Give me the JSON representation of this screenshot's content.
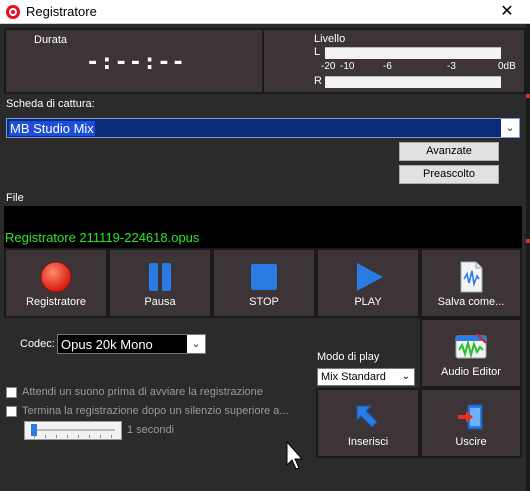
{
  "window": {
    "title": "Registratore",
    "close_glyph": "✕"
  },
  "display": {
    "duration_label": "Durata",
    "duration_value": "-:--:--",
    "level_label": "Livello",
    "left_channel": "L",
    "right_channel": "R",
    "scale": [
      "-20",
      "-10",
      "-6",
      "-3",
      "0dB"
    ]
  },
  "capture": {
    "label": "Scheda di cattura:",
    "selected": "MB Studio Mix",
    "advanced_button": "Avanzate",
    "preview_button": "Preascolto"
  },
  "file": {
    "label": "File",
    "name": "Registratore 211119-224618.opus",
    "name_color": "#2ee62e"
  },
  "transport": [
    {
      "label": "Registratore",
      "icon": "record-icon"
    },
    {
      "label": "Pausa",
      "icon": "pause-icon"
    },
    {
      "label": "STOP",
      "icon": "stop-icon"
    },
    {
      "label": "PLAY",
      "icon": "play-icon"
    },
    {
      "label": "Salva come...",
      "icon": "save-audio-icon"
    }
  ],
  "codec": {
    "label": "Codec:",
    "selected": "Opus 20k Mono"
  },
  "play_mode": {
    "label": "Modo di play",
    "selected": "Mix Standard"
  },
  "options": {
    "wait_sound": "Attendi un suono prima di avviare la registrazione",
    "stop_silence": "Termina la registrazione dopo un silenzio superiore a...",
    "silence_value": "1 secondi"
  },
  "actions": [
    {
      "label": "Audio Editor",
      "icon": "audio-editor-icon"
    },
    {
      "label": "Inserisci",
      "icon": "insert-arrow-icon"
    },
    {
      "label": "Uscire",
      "icon": "exit-door-icon"
    }
  ],
  "colors": {
    "accent_blue": "#2a7be4",
    "record_red": "#e53222",
    "panel": "#3c3437"
  }
}
